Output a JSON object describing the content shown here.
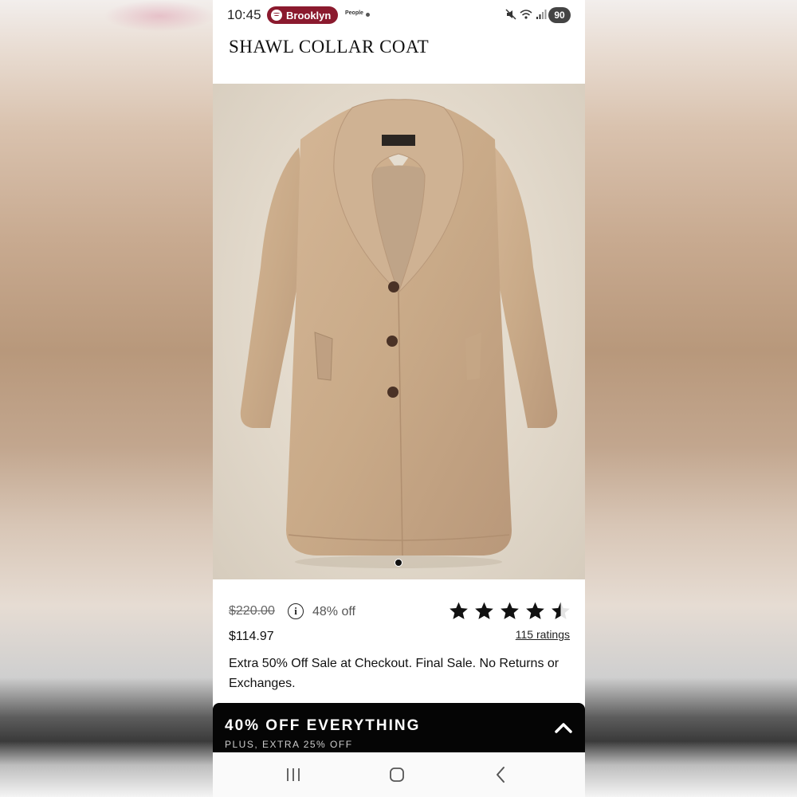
{
  "status_bar": {
    "time": "10:45",
    "spotify_label": "Brooklyn",
    "notification_text": "People",
    "battery": "90"
  },
  "product": {
    "title": "SHAWL COLLAR COAT",
    "original_price": "$220.00",
    "discount": "48% off",
    "sale_price": "$114.97",
    "rating": {
      "value": 4.5,
      "max": 5,
      "ratings_label": "115 ratings"
    },
    "sale_note": "Extra 50% Off Sale at Checkout. Final Sale. No Returns or Exchanges.",
    "carousel_current": 1
  },
  "promo": {
    "headline": "40% OFF EVERYTHING",
    "subline": "PLUS, EXTRA 25% OFF"
  },
  "icons": {
    "info": "info-icon",
    "star": "star-icon",
    "chevron": "chevron-up-icon",
    "nav_recents": "recents-icon",
    "nav_home": "home-icon",
    "nav_back": "back-icon"
  },
  "colors": {
    "spotify_pill": "#8b1a2e",
    "promo_banner": "#050505",
    "coat": "#c9ab8a"
  }
}
